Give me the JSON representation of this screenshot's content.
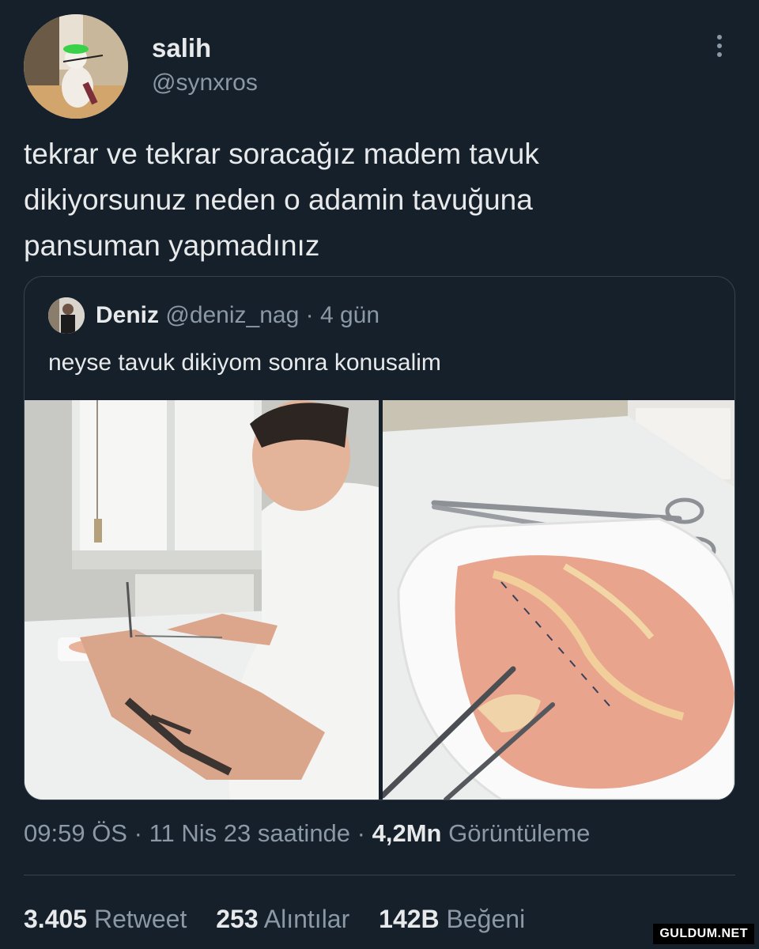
{
  "author": {
    "name": "salih",
    "handle": "@synxros"
  },
  "tweet": {
    "lines": [
      "tekrar ve tekrar soracağız madem tavuk",
      "dikiyorsunuz neden o adamin tavuğuna",
      "pansuman yapmadınız"
    ]
  },
  "quoted": {
    "name": "Deniz",
    "handle": "@deniz_nag",
    "separator": "·",
    "age": "4 gün",
    "text": "neyse tavuk dikiyom sonra konusalim"
  },
  "meta": {
    "time": "09:59 ÖS",
    "sep1": "·",
    "date": "11 Nis 23 saatinde",
    "sep2": "·",
    "views_count": "4,2Mn",
    "views_label": "Görüntüleme"
  },
  "stats": [
    {
      "count": "3.405",
      "label": "Retweet"
    },
    {
      "count": "253",
      "label": "Alıntılar"
    },
    {
      "count": "142B",
      "label": "Beğeni"
    }
  ],
  "watermark": "GULDUM.NET",
  "colors": {
    "background": "#15202b",
    "primary_text": "#e7e9ea",
    "secondary_text": "#8b98a5",
    "border": "#38444d"
  },
  "icons": {
    "more": "more-vertical-icon"
  }
}
